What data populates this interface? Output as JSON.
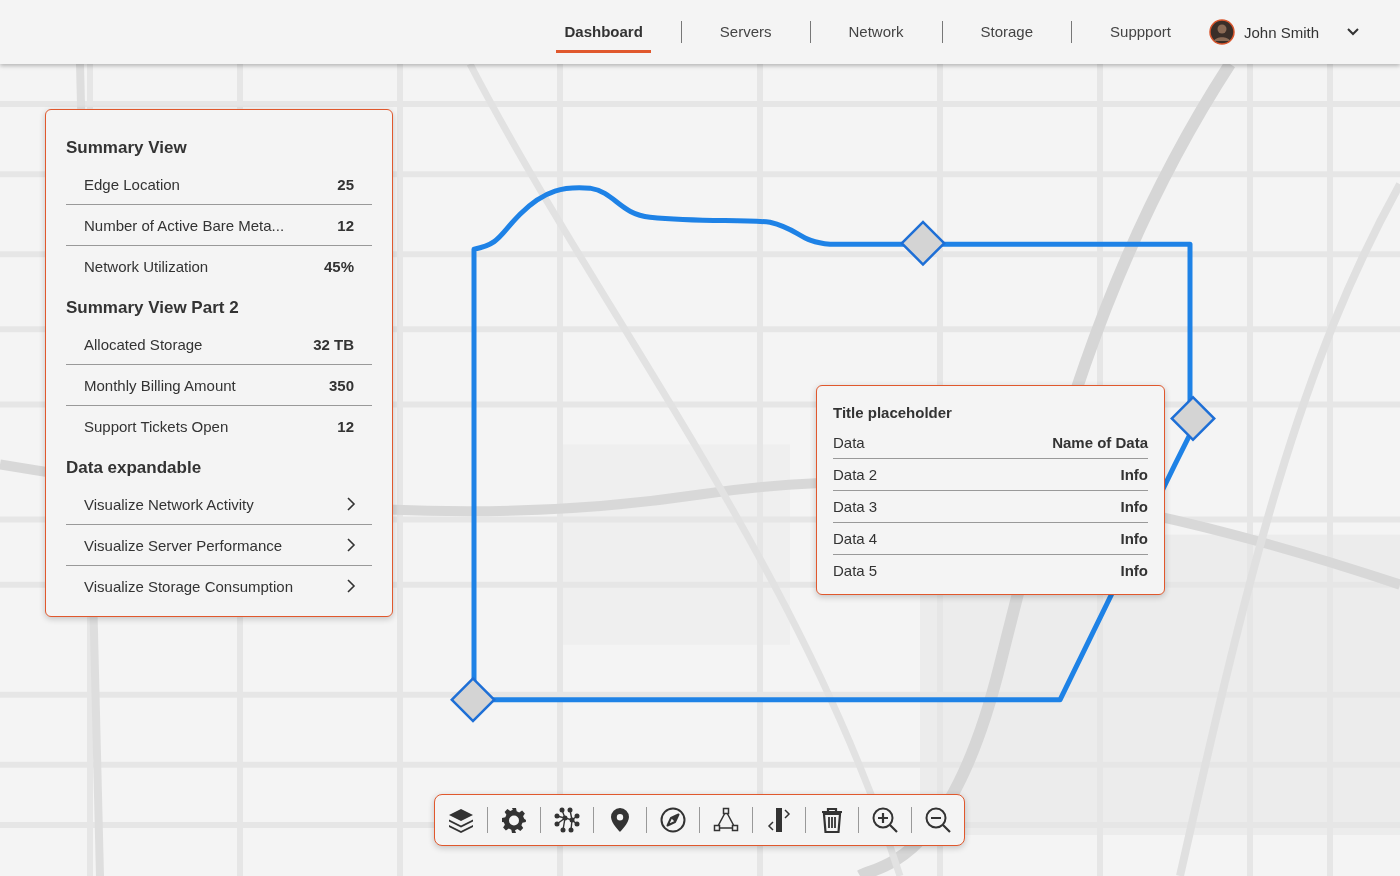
{
  "nav": [
    {
      "label": "Dashboard",
      "selected": true
    },
    {
      "label": "Servers",
      "selected": false
    },
    {
      "label": "Network",
      "selected": false
    },
    {
      "label": "Storage",
      "selected": false
    },
    {
      "label": "Suppport",
      "selected": false
    }
  ],
  "user": {
    "name": "John Smith"
  },
  "summary": [
    {
      "title": "Summary View",
      "kind": "stats",
      "rows": [
        {
          "label": "Edge Location",
          "value": "25"
        },
        {
          "label": "Number of Active Bare Meta...",
          "value": "12"
        },
        {
          "label": "Network Utilization",
          "value": "45%"
        }
      ]
    },
    {
      "title": "Summary View Part 2",
      "kind": "stats",
      "rows": [
        {
          "label": "Allocated Storage",
          "value": "32 TB"
        },
        {
          "label": "Monthly Billing Amount",
          "value": "350"
        },
        {
          "label": "Support Tickets Open",
          "value": "12"
        }
      ]
    },
    {
      "title": "Data expandable",
      "kind": "links",
      "rows": [
        {
          "label": "Visualize Network Activity"
        },
        {
          "label": "Visualize Server Performance"
        },
        {
          "label": "Visualize Storage Consumption"
        }
      ]
    }
  ],
  "popup": {
    "title": "Title placeholder",
    "rows": [
      {
        "label": "Data",
        "value": "Name of Data"
      },
      {
        "label": "Data 2",
        "value": "Info"
      },
      {
        "label": "Data 3",
        "value": "Info"
      },
      {
        "label": "Data 4",
        "value": "Info"
      },
      {
        "label": "Data 5",
        "value": "Info"
      }
    ]
  }
}
